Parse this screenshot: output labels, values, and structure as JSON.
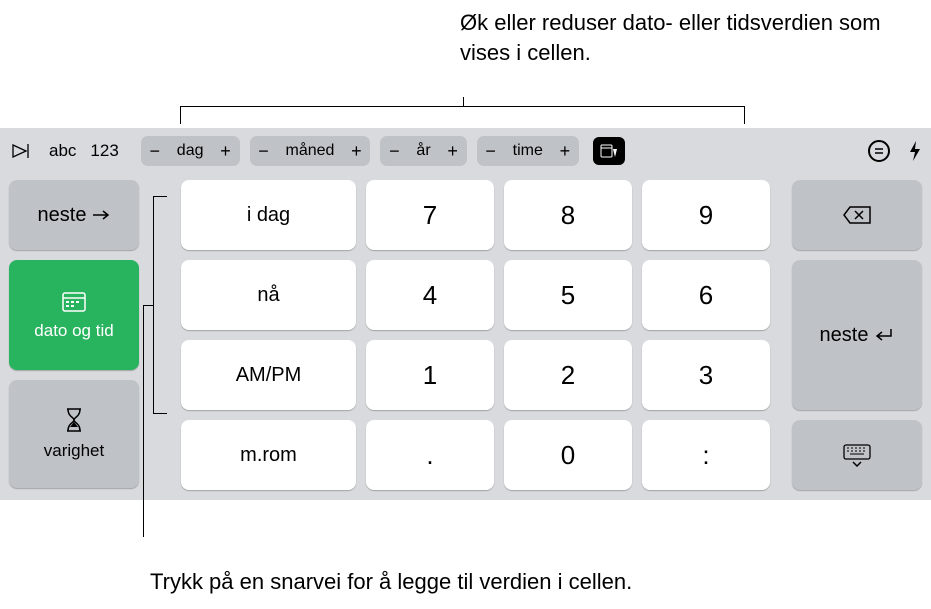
{
  "annotations": {
    "top": "Øk eller reduser dato- eller tidsverdien som vises i cellen.",
    "bottom": "Trykk på en snarvei for å legge til verdien i cellen."
  },
  "toolbar": {
    "abc": "abc",
    "num": "123",
    "steppers": [
      {
        "label": "dag"
      },
      {
        "label": "måned"
      },
      {
        "label": "år"
      },
      {
        "label": "time"
      }
    ]
  },
  "left": {
    "neste": "neste",
    "datetime": "dato og tid",
    "duration": "varighet"
  },
  "shortcuts": [
    "i dag",
    "nå",
    "AM/PM",
    "m.rom"
  ],
  "numpad": [
    [
      "7",
      "8",
      "9"
    ],
    [
      "4",
      "5",
      "6"
    ],
    [
      "1",
      "2",
      "3"
    ],
    [
      ".",
      "0",
      ":"
    ]
  ],
  "right": {
    "neste": "neste"
  }
}
